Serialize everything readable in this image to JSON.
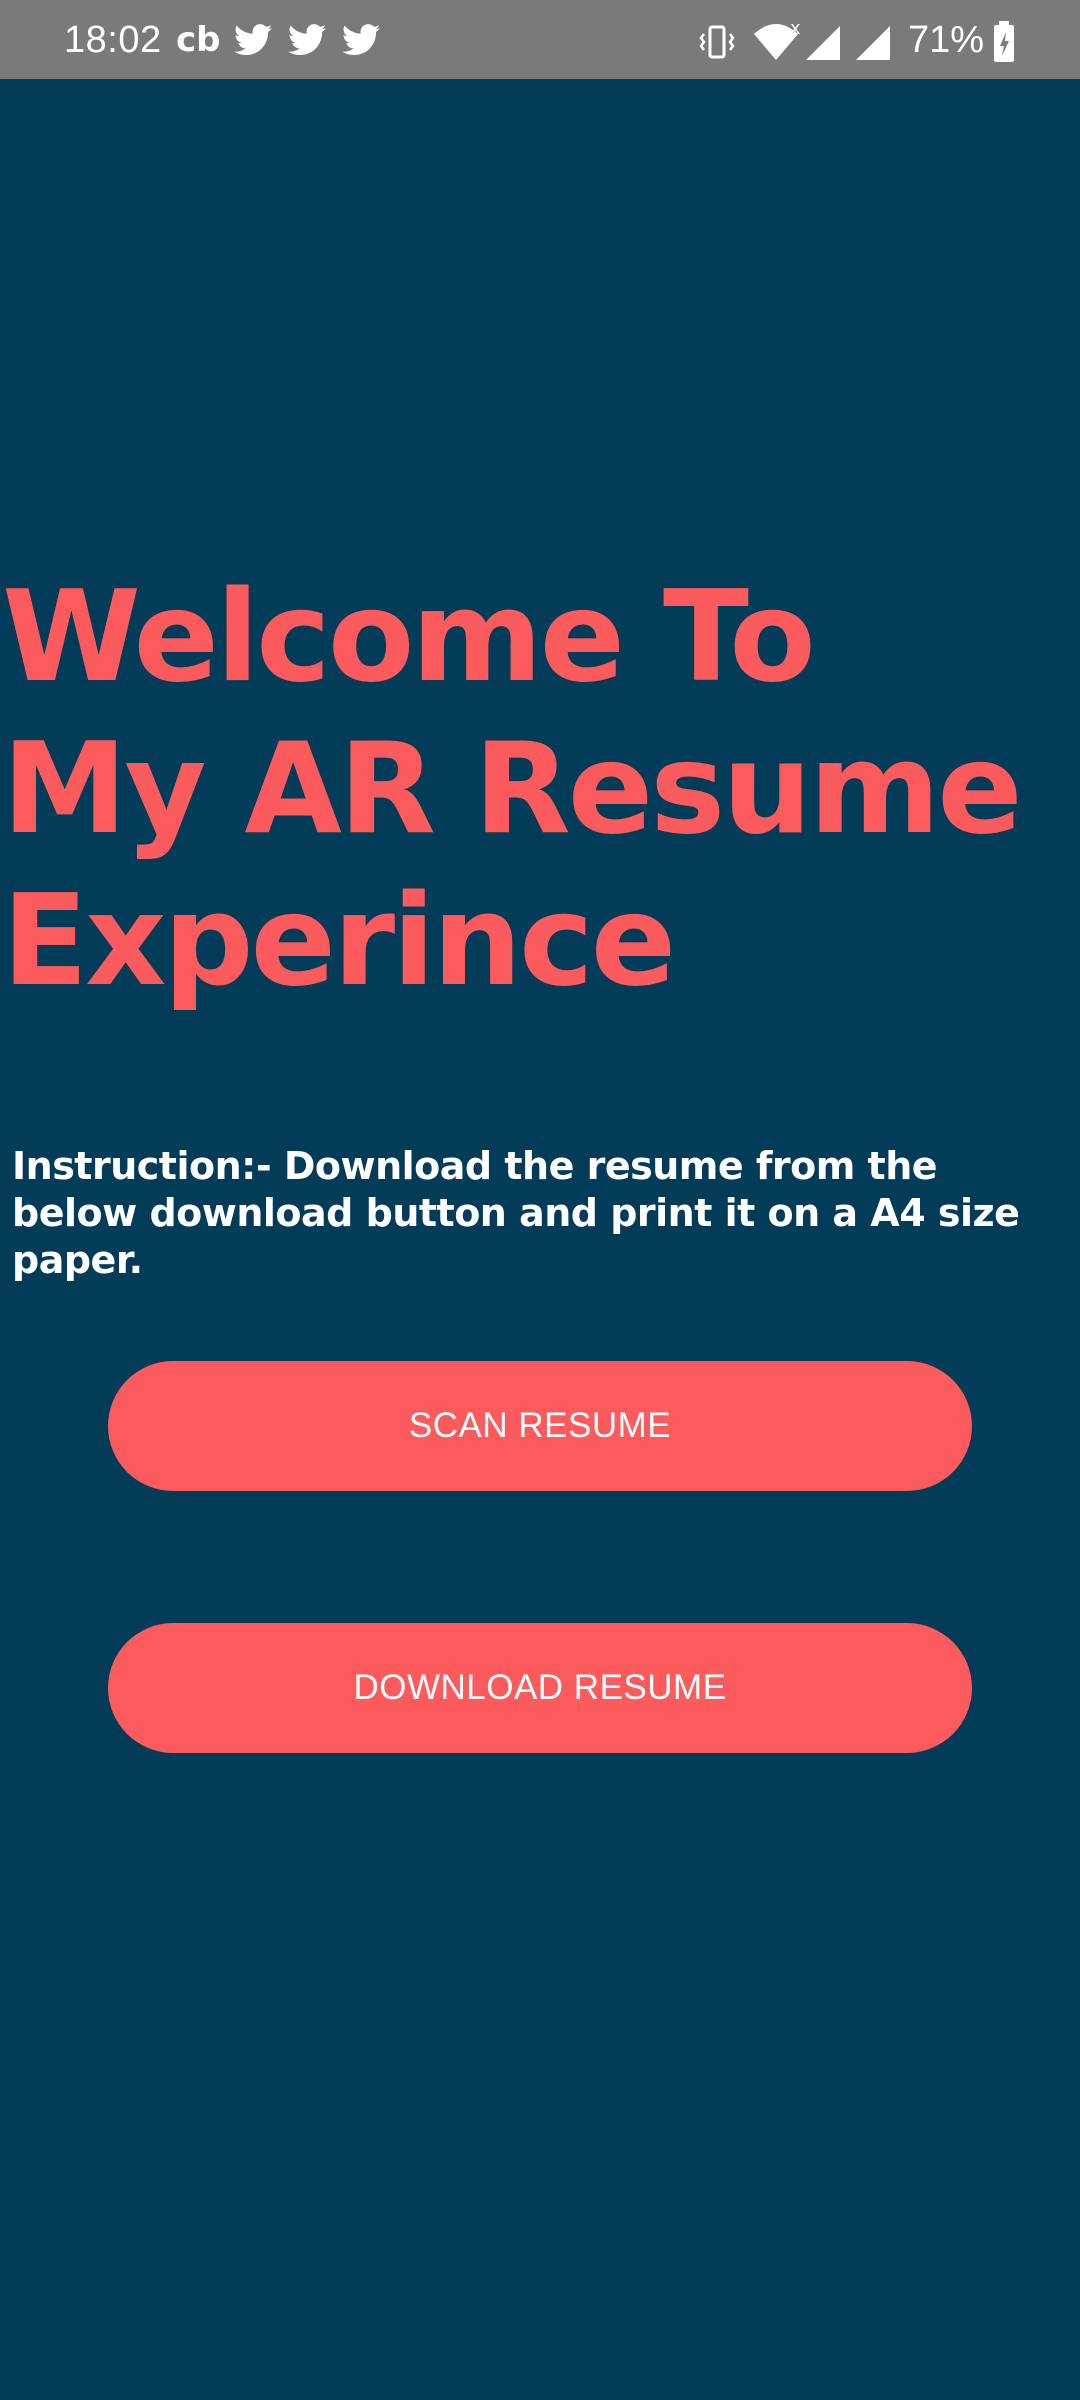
{
  "status_bar": {
    "time": "18:02",
    "battery_percent": "71%",
    "notification_icons": [
      "cb-icon",
      "twitter-icon",
      "twitter-icon",
      "twitter-icon"
    ],
    "system_icons": [
      "vibrate-icon",
      "wifi-icon",
      "signal-icon",
      "signal-icon",
      "battery-charging-icon"
    ],
    "wifi_badge": "x",
    "cb_text": "cb",
    "background": "#7a7a7a"
  },
  "main": {
    "title": "Welcome To\nMy AR Resume\nExperince",
    "instruction": "Instruction:- Download the resume from the below download button and print it on a A4 size paper.",
    "scan_button_label": "SCAN RESUME",
    "download_button_label": "DOWNLOAD RESUME"
  },
  "colors": {
    "background": "#023c59",
    "accent": "#fc5b5d",
    "text": "#ffffff"
  }
}
